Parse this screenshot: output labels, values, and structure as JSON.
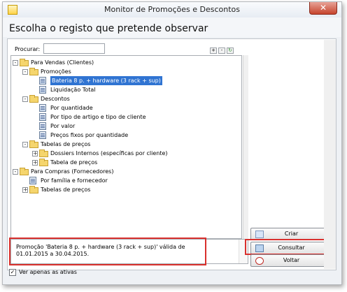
{
  "window": {
    "title": "Monitor de Promoções e Descontos",
    "close_label": "✕"
  },
  "header": {
    "title": "Escolha o registo que pretende observar"
  },
  "search": {
    "label": "Procurar:",
    "value": ""
  },
  "tree_toolbar": {
    "add_label": "+",
    "remove_label": "-",
    "refresh_label": "↻"
  },
  "tree": [
    {
      "label": "Para Vendas (Clientes)",
      "type": "folder",
      "level": 0,
      "expanded": true
    },
    {
      "label": "Promoções",
      "type": "folder",
      "level": 1,
      "expanded": true
    },
    {
      "label": "Bateria 8 p. + hardware (3 rack + sup)",
      "type": "doc",
      "level": 2,
      "selected": true
    },
    {
      "label": "Liquidação Total",
      "type": "doc",
      "level": 2
    },
    {
      "label": "Descontos",
      "type": "folder",
      "level": 1,
      "expanded": true
    },
    {
      "label": "Por quantidade",
      "type": "doc",
      "level": 2
    },
    {
      "label": "Por tipo de artigo e tipo de cliente",
      "type": "doc",
      "level": 2
    },
    {
      "label": "Por valor",
      "type": "doc",
      "level": 2
    },
    {
      "label": "Preços fixos por quantidade",
      "type": "doc",
      "level": 2
    },
    {
      "label": "Tabelas de preços",
      "type": "folder",
      "level": 1,
      "expanded": true
    },
    {
      "label": "Dossiers Internos (específicas por cliente)",
      "type": "folder",
      "level": 2,
      "expanded": false
    },
    {
      "label": "Tabela de preços",
      "type": "folder",
      "level": 2,
      "expanded": false
    },
    {
      "label": "Para Compras (Fornecedores)",
      "type": "folder",
      "level": 0,
      "expanded": true
    },
    {
      "label": "Por família e fornecedor",
      "type": "doc",
      "level": 1
    },
    {
      "label": "Tabelas de preços",
      "type": "folder",
      "level": 1,
      "expanded": false
    }
  ],
  "description": "Promoção 'Bateria 8 p. + hardware (3 rack + sup)' válida de 01.01.2015 a 30.04.2015.",
  "actions": {
    "create": "Criar",
    "consult": "Consultar",
    "back": "Voltar"
  },
  "footer": {
    "active_only_label": "Ver apenas as ativas",
    "active_only_checked": true
  },
  "colors": {
    "selection": "#3074d2",
    "highlight_border": "#d9302d",
    "folder": "#f5d56d"
  }
}
